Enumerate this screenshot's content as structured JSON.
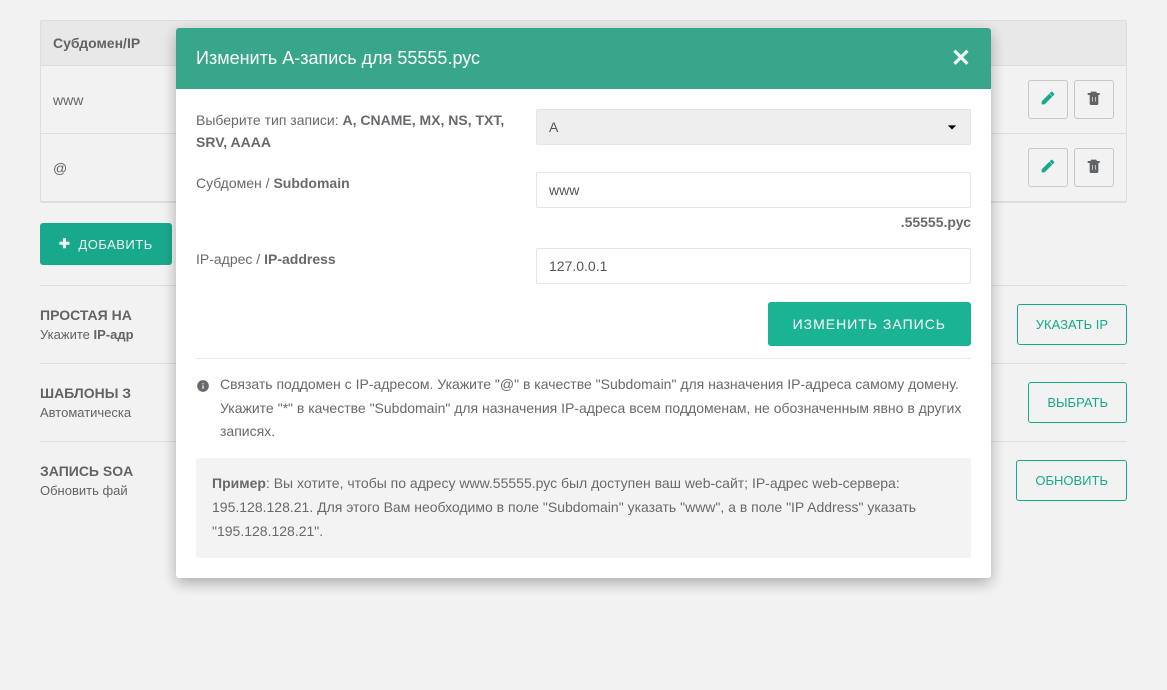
{
  "table": {
    "header_label": "Субдомен/IP",
    "rows": [
      {
        "name": "www"
      },
      {
        "name": "@"
      }
    ]
  },
  "add_btn": "ДОБАВИТЬ",
  "sections": {
    "simple": {
      "title": "ПРОСТАЯ НА",
      "sub_prefix": "Укажите ",
      "sub_bold": "IP-адр",
      "action": "УКАЗАТЬ IP"
    },
    "templates": {
      "title": "ШАБЛОНЫ З",
      "sub": "Автоматическа",
      "action": "ВЫБРАТЬ"
    },
    "soa": {
      "title": "ЗАПИСЬ SOA",
      "sub": "Обновить фай",
      "action": "ОБНОВИТЬ"
    }
  },
  "modal": {
    "title": "Изменить A-запись для 55555.рус",
    "type_label_pre": "Выберите тип записи: ",
    "type_label_bold": "A, CNAME, MX, NS, TXT, SRV, AAAA",
    "type_value": "A",
    "subdomain_label_pre": "Субдомен / ",
    "subdomain_label_bold": "Subdomain",
    "subdomain_value": "www",
    "domain_suffix": ".55555.рус",
    "ip_label_pre": "IP-адрес / ",
    "ip_label_bold": "IP-address",
    "ip_value": "127.0.0.1",
    "submit": "ИЗМЕНИТЬ ЗАПИСЬ",
    "info_text": "Связать поддомен с IP-адресом. Укажите \"@\" в качестве \"Subdomain\" для назначения IP-адреса самому домену. Укажите \"*\" в качестве \"Subdomain\" для назначения IP-адреса всем поддоменам, не обозначенным явно в других записях.",
    "example_label": "Пример",
    "example_text": ": Вы хотите, чтобы по адресу www.55555.рус был доступен ваш web-сайт; IP-адрес web-сервера: 195.128.128.21. Для этого Вам необходимо в поле \"Subdomain\" указать \"www\", а в поле \"IP Address\" указать \"195.128.128.21\"."
  }
}
